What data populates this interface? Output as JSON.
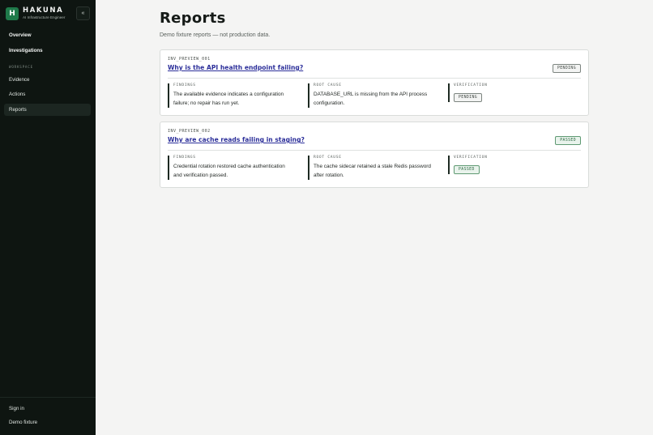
{
  "sidebar": {
    "brand": {
      "logo_letter": "H",
      "name": "HAKUNA",
      "subtitle": "AI Infrastructure Engineer"
    },
    "collapse_label": "«",
    "items_top": [
      {
        "label": "Overview"
      },
      {
        "label": "Investigations"
      }
    ],
    "section_label": "WORKSPACE",
    "items_workspace": [
      {
        "label": "Evidence"
      },
      {
        "label": "Actions"
      },
      {
        "label": "Reports"
      }
    ],
    "footer": [
      {
        "label": "Sign in"
      },
      {
        "label": "Demo fixture"
      }
    ]
  },
  "main": {
    "title": "Reports",
    "subtitle": "Demo fixture reports — not production data.",
    "reports": [
      {
        "id": "INV_PREVIEW_001",
        "title": "Why is the API health endpoint failing?",
        "status": "PENDING",
        "findings_label": "FINDINGS",
        "findings_line1": "The available evidence indicates a configuration",
        "findings_line2": "failure; no repair has run yet.",
        "root_cause_label": "ROOT CAUSE",
        "root_cause_line1": "DATABASE_URL is missing from the API process",
        "root_cause_line2": "configuration.",
        "verification_label": "VERIFICATION",
        "verification_status": "PENDING"
      },
      {
        "id": "INV_PREVIEW_002",
        "title": "Why are cache reads failing in staging?",
        "status": "PASSED",
        "findings_label": "FINDINGS",
        "findings_line1": "Credential rotation restored cache authentication",
        "findings_line2": "and verification passed.",
        "root_cause_label": "ROOT CAUSE",
        "root_cause_line1": "The cache sidecar retained a stale Redis password",
        "root_cause_line2": "after rotation.",
        "verification_label": "VERIFICATION",
        "verification_status": "PASSED"
      }
    ]
  },
  "colors": {
    "sidebar_bg": "#0e1511",
    "brand_green": "#1f7a4a",
    "link_title": "#2c2f9a",
    "passed": "#2c6a42",
    "pending": "#3e4540"
  }
}
